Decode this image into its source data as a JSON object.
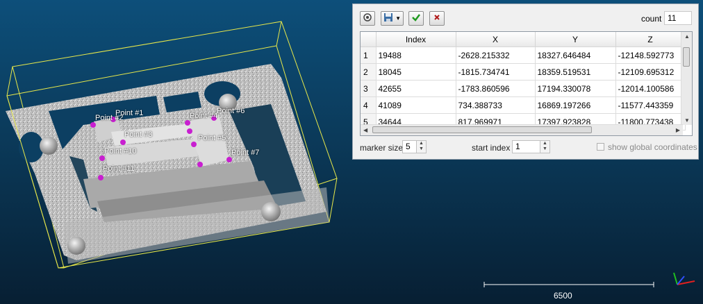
{
  "viewer": {
    "point_labels": [
      "Point #2",
      "Point #1",
      "Point #3",
      "Point #10",
      "Point #11",
      "Point #4",
      "Point #6",
      "Point #5",
      "Point #7"
    ],
    "scale_value": "6500",
    "colors": {
      "marker": "#c81fd0",
      "bounding_box": "#e8e84a",
      "background_top": "#0d4f7a"
    }
  },
  "panel": {
    "toolbar": {
      "reset_icon": "reset-icon",
      "save_icon": "floppy-disk-icon",
      "accept_icon": "green-check-icon",
      "cancel_icon": "red-x-icon"
    },
    "count_label": "count",
    "count_value": "11",
    "table": {
      "headers": [
        "Index",
        "X",
        "Y",
        "Z"
      ],
      "rows": [
        {
          "n": "1",
          "index": "19488",
          "x": "-2628.215332",
          "y": "18327.646484",
          "z": "-12148.592773"
        },
        {
          "n": "2",
          "index": "18045",
          "x": "-1815.734741",
          "y": "18359.519531",
          "z": "-12109.695312"
        },
        {
          "n": "3",
          "index": "42655",
          "x": "-1783.860596",
          "y": "17194.330078",
          "z": "-12014.100586"
        },
        {
          "n": "4",
          "index": "41089",
          "x": "734.388733",
          "y": "16869.197266",
          "z": "-11577.443359"
        },
        {
          "n": "5",
          "index": "34644",
          "x": "817.969971",
          "y": "17397.923828",
          "z": "-11800.773438"
        }
      ]
    },
    "marker_size_label": "marker size",
    "marker_size_value": "5",
    "start_index_label": "start index",
    "start_index_value": "1",
    "global_coords_label": "show global coordinates"
  }
}
